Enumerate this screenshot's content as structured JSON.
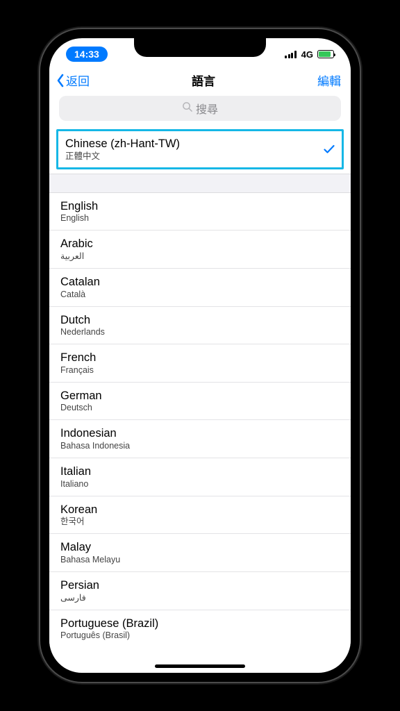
{
  "status": {
    "time": "14:33",
    "network": "4G"
  },
  "nav": {
    "back_label": "返回",
    "title": "語言",
    "edit_label": "編輯"
  },
  "search": {
    "placeholder": "搜尋"
  },
  "selected": {
    "name": "Chinese (zh-Hant-TW)",
    "native": "正體中文"
  },
  "languages": [
    {
      "name": "English",
      "native": "English"
    },
    {
      "name": "Arabic",
      "native": "العربية"
    },
    {
      "name": "Catalan",
      "native": "Català"
    },
    {
      "name": "Dutch",
      "native": "Nederlands"
    },
    {
      "name": "French",
      "native": "Français"
    },
    {
      "name": "German",
      "native": "Deutsch"
    },
    {
      "name": "Indonesian",
      "native": "Bahasa Indonesia"
    },
    {
      "name": "Italian",
      "native": "Italiano"
    },
    {
      "name": "Korean",
      "native": "한국어"
    },
    {
      "name": "Malay",
      "native": "Bahasa Melayu"
    },
    {
      "name": "Persian",
      "native": "فارسی"
    },
    {
      "name": "Portuguese (Brazil)",
      "native": "Português (Brasil)"
    }
  ]
}
